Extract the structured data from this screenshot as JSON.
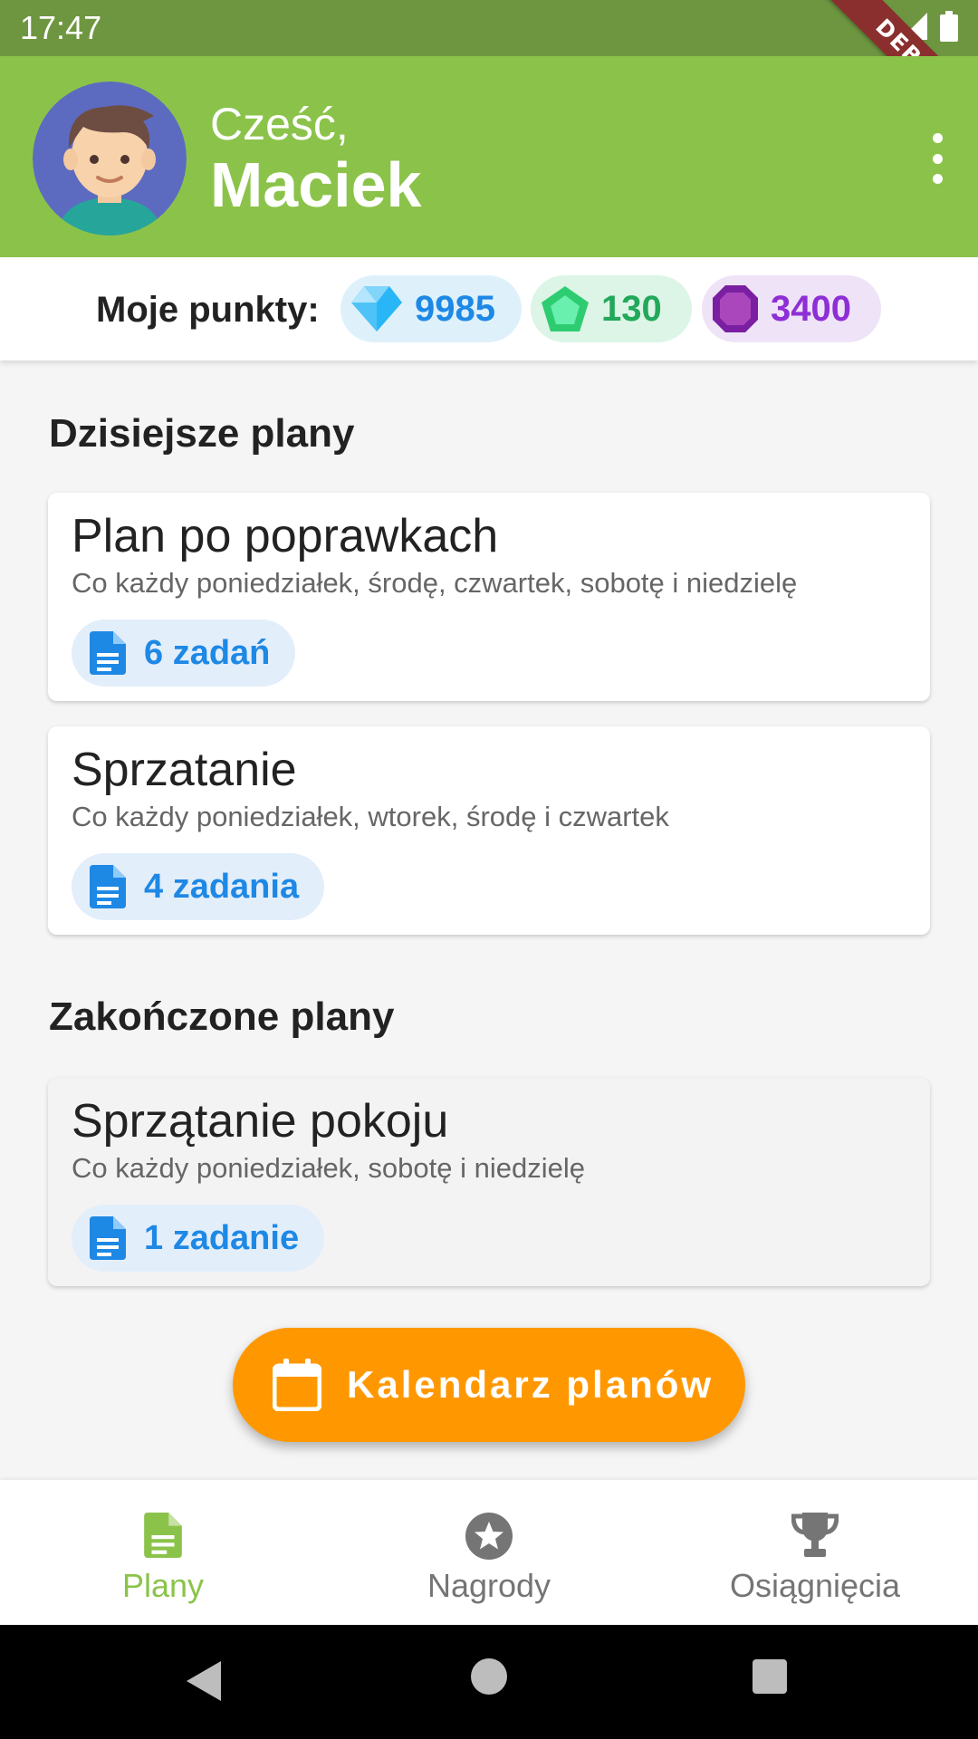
{
  "status_bar": {
    "time": "17:47",
    "debug_label": "DEBUG"
  },
  "header": {
    "greeting": "Cześć,",
    "user_name": "Maciek"
  },
  "points": {
    "label": "Moje punkty:",
    "items": [
      {
        "icon": "blue-gem-icon",
        "value": "9985",
        "color": "#1e88e5"
      },
      {
        "icon": "green-gem-icon",
        "value": "130",
        "color": "#22a85a"
      },
      {
        "icon": "purple-gem-icon",
        "value": "3400",
        "color": "#8e2fd6"
      }
    ]
  },
  "today": {
    "title": "Dzisiejsze plany",
    "plans": [
      {
        "name": "Plan po poprawkach",
        "schedule": "Co każdy poniedziałek, środę, czwartek, sobotę i niedzielę",
        "tasks": "6 zadań"
      },
      {
        "name": "Sprzatanie",
        "schedule": "Co każdy poniedziałek, wtorek, środę i czwartek",
        "tasks": "4 zadania"
      }
    ]
  },
  "finished": {
    "title": "Zakończone plany",
    "plans": [
      {
        "name": "Sprzątanie pokoju",
        "schedule": "Co każdy poniedziałek, sobotę i niedzielę",
        "tasks": "1 zadanie"
      }
    ]
  },
  "calendar_button": {
    "label": "Kalendarz planów",
    "icon": "calendar-icon"
  },
  "bottom_nav": {
    "items": [
      {
        "label": "Plany",
        "icon": "document-icon",
        "active": true
      },
      {
        "label": "Nagrody",
        "icon": "star-icon",
        "active": false
      },
      {
        "label": "Osiągnięcia",
        "icon": "trophy-icon",
        "active": false
      }
    ]
  },
  "colors": {
    "appbar": "#8bc34a",
    "accent": "#ff9800",
    "task_chip_text": "#1e88e5"
  }
}
